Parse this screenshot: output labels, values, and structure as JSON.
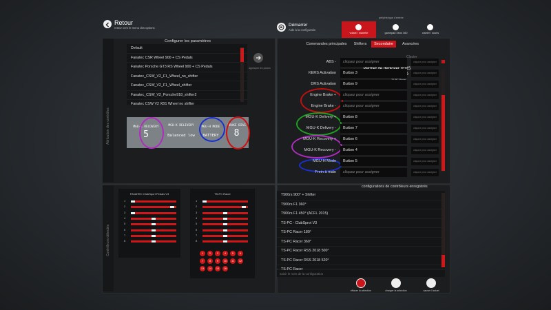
{
  "header": {
    "back_title": "Retour",
    "back_sub": "retour vers le menu des options",
    "start_title": "Démarrer",
    "start_sub": "Aide à la configuratio",
    "peripherals_label": "périphérique d'entrée",
    "devices": [
      {
        "label": "volant / manette",
        "icon": "steering-wheel-icon"
      },
      {
        "label": "gamepad Xbox 360",
        "icon": "gamepad-icon"
      },
      {
        "label": "clavier / souris",
        "icon": "keyboard-mouse-icon"
      }
    ]
  },
  "side_labels": {
    "top": "Attribution des contrôles",
    "bottom": "Contrôleurs détectés"
  },
  "configure": {
    "title": "Configurer les paramètres",
    "items": [
      "Default",
      "Fanatec CSR Wheel 900 + CS Pedals",
      "Fanatec Porsche GT3 RS Wheel 900 + CS Pedals",
      "Fanatec_CSW_V2_F1_Wheel_no_shifter",
      "Fanatec_CSW_V2_F1_Wheel_shifter",
      "Fanatec_CSW_V2_Porsche918_shifter2",
      "Fanatec CSW V2 XB1 Wheel no shifter"
    ],
    "apply_label": "appliquer les param"
  },
  "tiles": [
    {
      "label": "MGU-K RECOVERY",
      "value": "5"
    },
    {
      "label": "MGU-K DELIVERY",
      "value": "Balanced low"
    },
    {
      "label": "MGU-H MODE",
      "value": "BATTERY"
    },
    {
      "label": "BRAKE BIAS",
      "value": "8"
    }
  ],
  "tabs": [
    "Commandes principales",
    "Shifters",
    "Secondaire",
    "Avancées"
  ],
  "active_tab": "Secondaire",
  "column_header": "Clavier",
  "tooltip_top": "TS-PC Racer",
  "annotation": "Permet de déployer l'ERS à 100% quand enfoncé",
  "bindings": [
    {
      "label": "ABS -",
      "value": "cliquez pour assigner",
      "aux": "cliquez pour assigner",
      "placeholder": true
    },
    {
      "label": "KERS Activation",
      "value": "Button 3",
      "aux": "cliquez pour assigner",
      "placeholder": false
    },
    {
      "label": "DRS Activation",
      "value": "Button 9",
      "aux": "cliquez pour assigner",
      "placeholder": false
    },
    {
      "label": "Engine Brake +",
      "value": "cliquez pour assigner",
      "aux": "cliquez pour assigner",
      "placeholder": true
    },
    {
      "label": "Engine Brake -",
      "value": "cliquez pour assigner",
      "aux": "cliquez pour assigner",
      "placeholder": true
    },
    {
      "label": "MGU-K Delivery +",
      "value": "Button 8",
      "aux": "cliquez pour assigner",
      "placeholder": false
    },
    {
      "label": "MGU-K Delivery -",
      "value": "Button 7",
      "aux": "cliquez pour assigner",
      "placeholder": false
    },
    {
      "label": "MGU-K Recovery +",
      "value": "Button 6",
      "aux": "cliquez pour assigner",
      "placeholder": false
    },
    {
      "label": "MGU-K Recovery -",
      "value": "Button 4",
      "aux": "cliquez pour assigner",
      "placeholder": false
    },
    {
      "label": "MGU-H Mode",
      "value": "Button 5",
      "aux": "cliquez pour assigner",
      "placeholder": false
    },
    {
      "label": "Frein à main",
      "value": "cliquez pour assigner",
      "aux": "cliquez pour assigner",
      "placeholder": true
    }
  ],
  "controllers": {
    "pedals": {
      "title": "FANATEC ClubSport Pedals V3",
      "axes": [
        {
          "num": "1",
          "value": 0.0
        },
        {
          "num": "2",
          "value": 0.95
        },
        {
          "num": "3",
          "value": 0.0
        },
        {
          "num": "4",
          "value": 0.5
        },
        {
          "num": "5",
          "value": 0.5
        },
        {
          "num": "6",
          "value": 0.5
        },
        {
          "num": "7",
          "value": 0.5
        },
        {
          "num": "8",
          "value": 0.5
        }
      ]
    },
    "racer": {
      "title": "TS-PC Racer",
      "axes": [
        {
          "num": "1",
          "value": 0.0
        },
        {
          "num": "2",
          "value": 0.95
        },
        {
          "num": "3",
          "value": 0.5
        },
        {
          "num": "4",
          "value": 0.5
        },
        {
          "num": "5",
          "value": 0.5
        },
        {
          "num": "6",
          "value": 0.5
        },
        {
          "num": "7",
          "value": 0.5
        },
        {
          "num": "8",
          "value": 0.5
        }
      ],
      "buttons": [
        "1",
        "2",
        "3",
        "4",
        "5",
        "6",
        "7",
        "8",
        "9",
        "10",
        "11",
        "12",
        "13",
        "14",
        "15",
        "16"
      ]
    }
  },
  "saved": {
    "title": "configurations de contrôleurs enregistrés",
    "items": [
      "T500rs 900° + Shifter",
      "T500rs F1 360°",
      "T500rs F1 450° (ACFL 2015)",
      "TS-PC - ClubSprot V3",
      "TS-PC Racer 180°",
      "TS-PC Racer 360°",
      "TS-PC Racer RSS 2018 500°",
      "TS-PC Racer RSS 2018 520°",
      "TS-PC Racer"
    ],
    "input_placeholder": "saisir le nom de la configuration"
  },
  "bottom_buttons": [
    {
      "label": "effacer la sélection",
      "icon": "delete-icon"
    },
    {
      "label": "charger la sélection",
      "icon": "load-icon"
    },
    {
      "label": "sauver l'actuel",
      "icon": "save-icon"
    }
  ],
  "colors": {
    "accent": "#c8161c",
    "panel": "#1c1d1f",
    "list": "#141516"
  }
}
